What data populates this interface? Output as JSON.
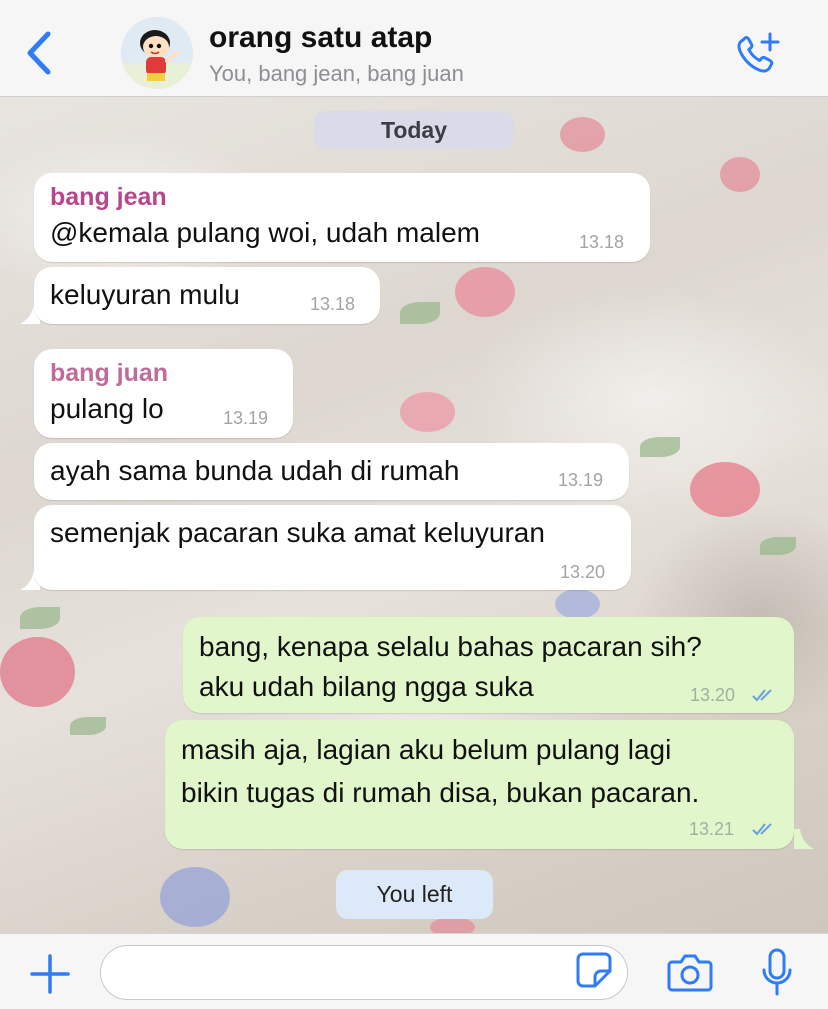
{
  "header": {
    "title": "orang satu atap",
    "subtitle": "You, bang jean, bang juan",
    "back_icon": "chevron-left-icon",
    "call_icon": "phone-add-icon"
  },
  "chat": {
    "date_label": "Today",
    "messages": [
      {
        "sender": "bang jean",
        "text": "@kemala pulang woi, udah malem",
        "time": "13.18"
      },
      {
        "text": "keluyuran mulu",
        "time": "13.18"
      },
      {
        "sender": "bang juan",
        "text": "pulang lo",
        "time": "13.19"
      },
      {
        "text": "ayah sama bunda udah di rumah",
        "time": "13.19"
      },
      {
        "text": "semenjak pacaran suka amat keluyuran",
        "time": "13.20"
      },
      {
        "lines": [
          "bang, kenapa selalu bahas pacaran sih?",
          "aku udah bilang ngga suka"
        ],
        "time": "13.20"
      },
      {
        "lines": [
          "masih aja, lagian aku belum pulang lagi",
          "bikin tugas di rumah disa, bukan pacaran."
        ],
        "time": "13.21"
      }
    ],
    "system_notice": "You left"
  },
  "colors": {
    "accent": "#2f7cf6",
    "jean_name": "#b8468f",
    "juan_name": "#c16b9c",
    "outgoing_bubble": "#e1f7cb",
    "incoming_bubble": "#ffffff",
    "notice_bubble": "#dce9f8"
  },
  "bottom_bar": {
    "plus_icon": "plus-icon",
    "input_value": "",
    "sticker_icon": "sticker-icon",
    "camera_icon": "camera-icon",
    "mic_icon": "microphone-icon"
  }
}
